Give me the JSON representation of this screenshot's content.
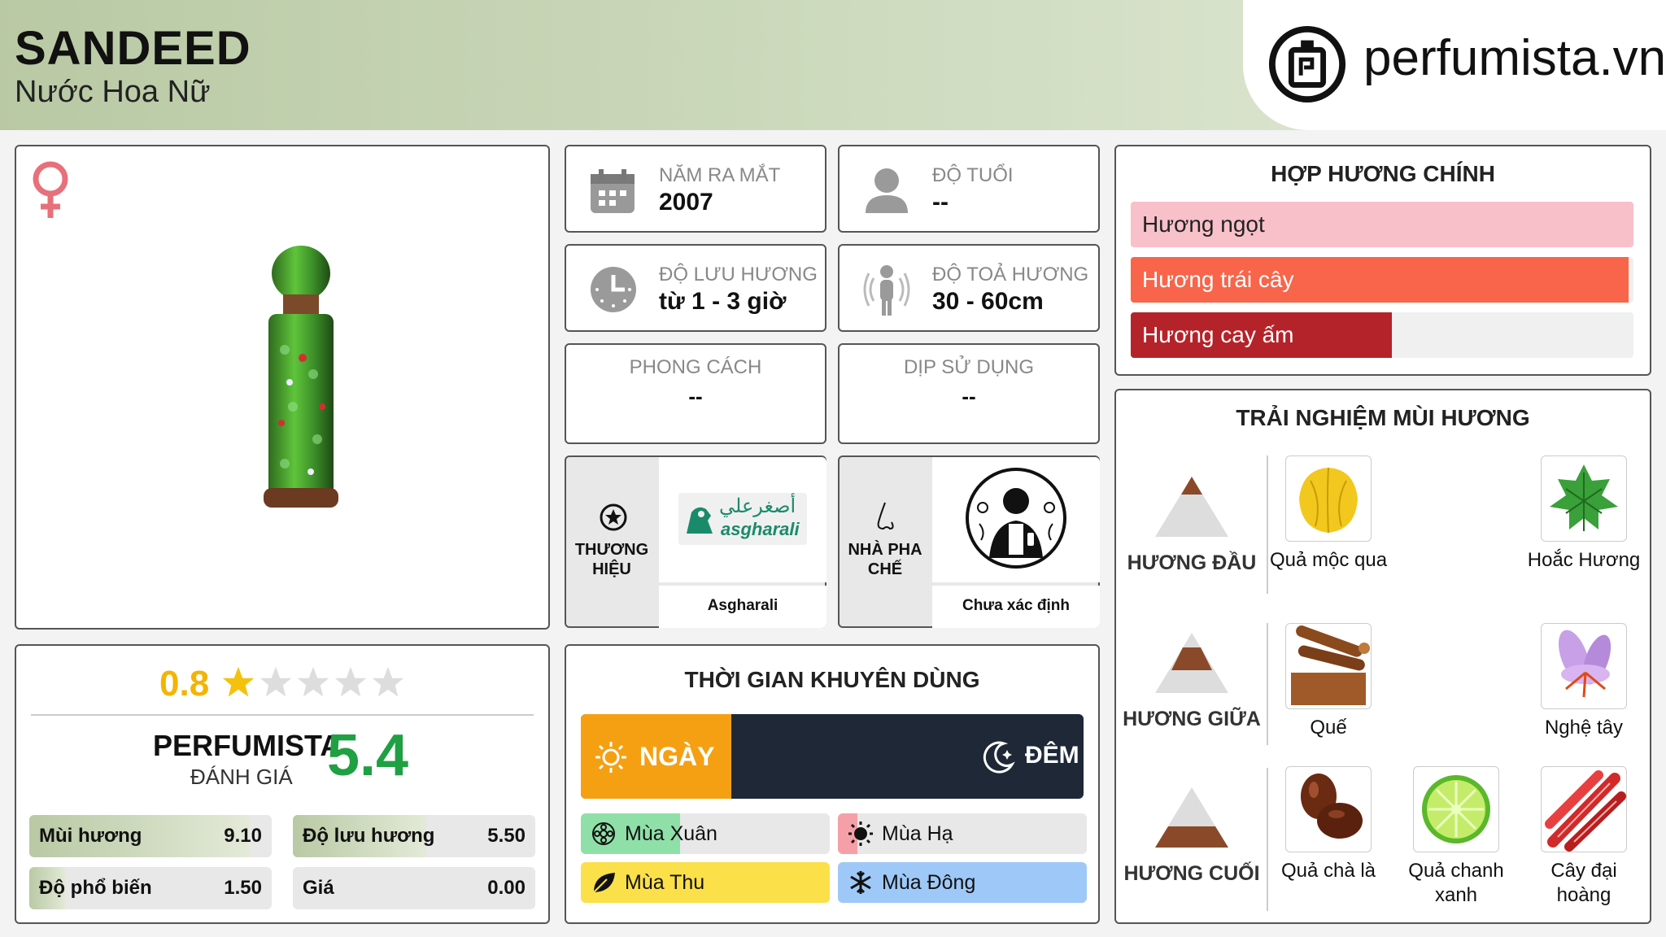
{
  "header": {
    "title": "SANDEED",
    "subtitle": "Nước Hoa Nữ",
    "logo_text": "perfumista.vn"
  },
  "info": {
    "year": {
      "label": "NĂM RA MẮT",
      "value": "2007"
    },
    "age": {
      "label": "ĐỘ TUỔI",
      "value": "--"
    },
    "longevity": {
      "label": "ĐỘ LƯU HƯƠNG",
      "value": "từ 1 - 3 giờ"
    },
    "sillage": {
      "label": "ĐỘ TOẢ HƯƠNG",
      "value": "30 - 60cm"
    },
    "style": {
      "label": "PHONG CÁCH",
      "value": "--"
    },
    "occasion": {
      "label": "DỊP SỬ DỤNG",
      "value": "--"
    },
    "brand": {
      "label_line1": "THƯƠNG",
      "label_line2": "HIỆU",
      "name": "Asgharali",
      "logo_arabic": "أصغرعلي",
      "logo_latin": "asgharali"
    },
    "perfumer": {
      "label_line1": "NHÀ PHA",
      "label_line2": "CHẾ",
      "name": "Chưa xác định"
    }
  },
  "rating": {
    "score": "0.8",
    "stars_filled": 1,
    "stars_total": 5,
    "perfumista_label": "PERFUMISTA",
    "review_label": "ĐÁNH GIÁ",
    "perfumista_score": "5.4",
    "stats": [
      {
        "name": "Mùi hương",
        "value": "9.10",
        "fill": 0.91
      },
      {
        "name": "Độ lưu hương",
        "value": "5.50",
        "fill": 0.55
      },
      {
        "name": "Độ phổ biến",
        "value": "1.50",
        "fill": 0.15
      },
      {
        "name": "Giá",
        "value": "0.00",
        "fill": 0.0
      }
    ]
  },
  "time": {
    "title": "THỜI GIAN KHUYÊN DÙNG",
    "day_label": "NGÀY",
    "night_label": "ĐÊM",
    "day_fraction": 0.3,
    "seasons": [
      {
        "name": "Mùa Xuân",
        "fill": 0.4,
        "color": "#8fe0a8"
      },
      {
        "name": "Mùa Hạ",
        "fill": 0.08,
        "color": "#f5a0a8"
      },
      {
        "name": "Mùa Thu",
        "fill": 1.0,
        "color": "#fbe04a"
      },
      {
        "name": "Mùa Đông",
        "fill": 1.0,
        "color": "#9ec8f8"
      }
    ]
  },
  "accords": {
    "title": "HỢP HƯƠNG CHÍNH",
    "items": [
      {
        "name": "Hương ngọt",
        "fill": 1.0,
        "color": "#f8c0c8",
        "text": "#222"
      },
      {
        "name": "Hương trái cây",
        "fill": 0.99,
        "color": "#f8654a",
        "text": "#ffffff"
      },
      {
        "name": "Hương cay ấm",
        "fill": 0.52,
        "color": "#b5232a",
        "text": "#ffffff"
      }
    ]
  },
  "notes": {
    "title": "TRẢI NGHIỆM MÙI HƯƠNG",
    "top_label": "HƯƠNG ĐẦU",
    "mid_label": "HƯƠNG GIỮA",
    "base_label": "HƯƠNG CUỐI",
    "top": [
      "Quả mộc qua",
      "Hoắc Hương"
    ],
    "mid": [
      "Quế",
      "Nghệ tây"
    ],
    "base": [
      "Quả chà là",
      "Quả chanh xanh",
      "Cây đại hoàng"
    ]
  },
  "colors": {
    "accent_green": "#1fa043",
    "star_gold": "#f4c20d",
    "score_gold": "#f4b400",
    "night": "#1e2837",
    "day": "#f5a013",
    "female": "#e8707a"
  }
}
